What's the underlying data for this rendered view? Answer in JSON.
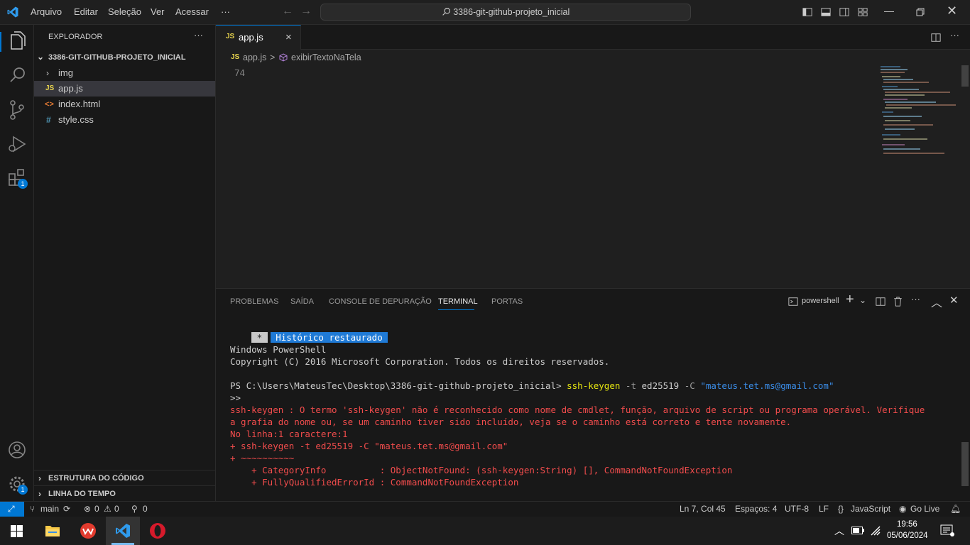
{
  "menu": [
    "Arquivo",
    "Editar",
    "Seleção",
    "Ver",
    "Acessar",
    "···"
  ],
  "command_center": "3386-git-github-projeto_inicial",
  "sidebar": {
    "title": "EXPLORADOR",
    "more": "···",
    "folder": "3386-GIT-GITHUB-PROJETO_INICIAL",
    "items": [
      {
        "label": "img",
        "icon": "chevron-right-icon"
      },
      {
        "label": "app.js",
        "icon": "js-file-icon",
        "prefix": "JS"
      },
      {
        "label": "index.html",
        "icon": "html-file-icon",
        "prefix": "<>"
      },
      {
        "label": "style.css",
        "icon": "css-file-icon",
        "prefix": "#"
      }
    ],
    "outline": "ESTRUTURA DO CÓDIGO",
    "timeline": "LINHA DO TEMPO"
  },
  "activity": {
    "extensions_badge": "1",
    "settings_badge": "1"
  },
  "tab": {
    "prefix": "JS",
    "label": "app.js",
    "close": "×"
  },
  "breadcrumb": {
    "prefix": "JS",
    "file": "app.js",
    "separator": ">",
    "symbol": "exibirTextoNaTela"
  },
  "editor": {
    "line_number": "74"
  },
  "panel": {
    "tabs": [
      "PROBLEMAS",
      "SAÍDA",
      "CONSOLE DE DEPURAÇÃO",
      "TERMINAL",
      "PORTAS"
    ],
    "active_tab": "TERMINAL",
    "shell": "powershell"
  },
  "terminal": {
    "restored_star": " * ",
    "restored_text": " Histórico restaurado ",
    "line1": "Windows PowerShell",
    "line2": "Copyright (C) 2016 Microsoft Corporation. Todos os direitos reservados.",
    "prompt": "PS C:\\Users\\MateusTec\\Desktop\\3386-git-github-projeto_inicial>",
    "cmd": "ssh-keygen",
    "arg1": "-t",
    "arg2": "ed25519",
    "arg3": "-C",
    "arg4": "\"mateus.tet.ms@gmail.com\"",
    "cont": ">>",
    "err1": "ssh-keygen : O termo 'ssh-keygen' não é reconhecido como nome de cmdlet, função, arquivo de script ou programa operável. Verifique",
    "err2": "a grafia do nome ou, se um caminho tiver sido incluído, veja se o caminho está correto e tente novamente.",
    "err3": "No linha:1 caractere:1",
    "err4": "+ ssh-keygen -t ed25519 -C \"mateus.tet.ms@gmail.com\"",
    "err5": "+ ~~~~~~~~~~",
    "err6": "    + CategoryInfo          : ObjectNotFound: (ssh-keygen:String) [], CommandNotFoundException",
    "err7": "    + FullyQualifiedErrorId : CommandNotFoundException"
  },
  "status": {
    "branch": "main",
    "errors": "0",
    "warnings": "0",
    "ports": "0",
    "position": "Ln 7, Col 45",
    "spaces": "Espaços: 4",
    "encoding": "UTF-8",
    "eol": "LF",
    "language": "JavaScript",
    "golive": "Go Live"
  },
  "taskbar": {
    "time": "19:56",
    "date": "05/06/2024"
  },
  "colors": {
    "accent": "#0078d4",
    "error": "#f14c4c",
    "js": "#e8d44d",
    "html": "#e37933",
    "css": "#519aba"
  }
}
